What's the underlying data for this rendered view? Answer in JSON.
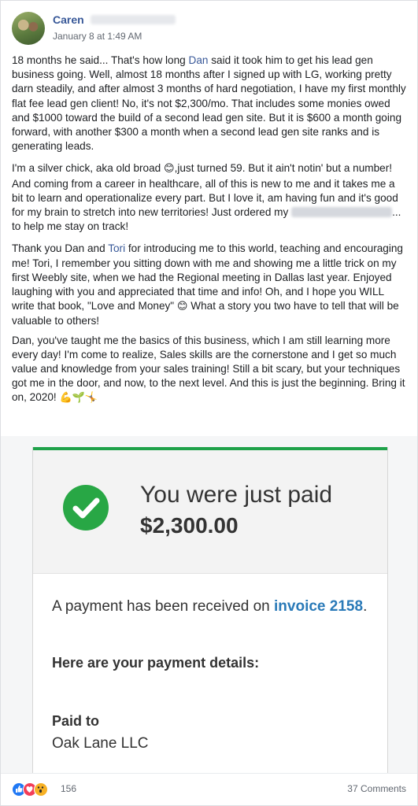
{
  "post": {
    "author": "Caren",
    "timestamp": "January 8 at 1:49 AM",
    "paragraphs": {
      "p1": "18 months he said... That's how long Dan said it took him to get his lead gen business going. Well, almost 18 months after I signed up with LG, working pretty darn steadily, and after almost 3 months of hard negotiation, I have my first monthly flat fee lead gen client! No, it's not $2,300/mo. That includes some monies owed and $1000 toward the build of a second lead gen site. But it is $600 a month going forward, with another $300 a month when a second lead gen site ranks and is generating leads.",
      "p2a": "I'm a silver chick, aka old broad ",
      "p2b": ",just turned 59. But it ain't notin' but a number! And coming from a career in healthcare, all of this is new to me and it takes me a bit to learn and operationalize every part. But I love it, am having fun and it's good for my brain to stretch into new territories! Just ordered my ",
      "p2c": "... to help me stay on track!",
      "p3a": "Thank you Dan and ",
      "p3_tori": "Tori",
      "p3b": " for introducing me to this world, teaching and encouraging me! Tori, I remember you sitting down with me and showing me a little trick on my first Weebly site, when we had the Regional meeting in Dallas last year. Enjoyed laughing with you and appreciated that time and info! Oh, and I hope you WILL write that book, \"Love and Money\" ",
      "p3c": " What a story you two have to tell that will be valuable to others!",
      "p4": "Dan, you've taught me the basics of this business, which I am still learning more every day! I'm come to realize, Sales skills are the cornerstone and I get so much value and knowledge from your sales training! Still a bit scary, but your techniques got me in the door, and now, to the next level. And this is just the beginning. Bring it on, 2020! ",
      "p4_emoji": "💪🌱🤸"
    },
    "emoji_smile": "😊"
  },
  "receipt": {
    "title": "You were just paid",
    "amount": "$2,300.00",
    "line_a": "A payment has been received on ",
    "invoice_link": "invoice 2158",
    "line_b": ".",
    "details_heading": "Here are your payment details:",
    "paid_to_label": "Paid to",
    "paid_to_value": "Oak Lane LLC",
    "accent_color": "#1fa24a",
    "link_color": "#2a7ab8"
  },
  "footer": {
    "reaction_icons": [
      "like-icon",
      "love-icon",
      "wow-icon"
    ],
    "reaction_count": "156",
    "comments": "37 Comments"
  }
}
